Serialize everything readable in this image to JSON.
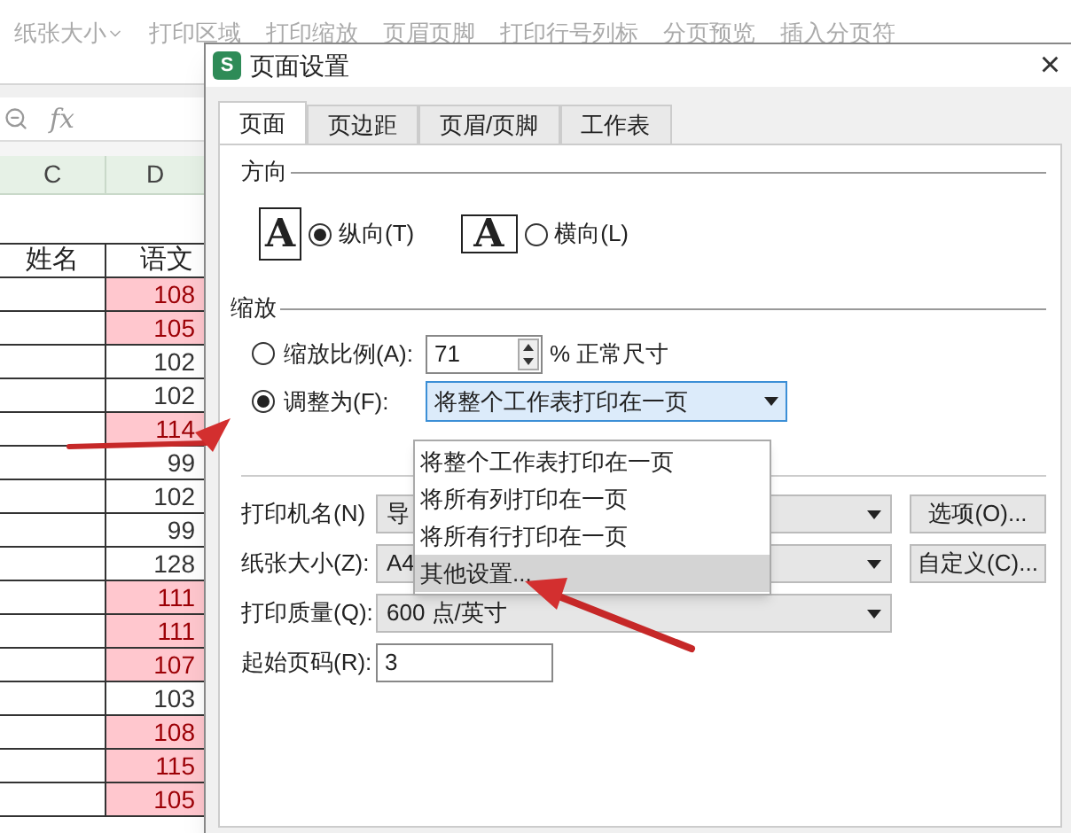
{
  "ribbon": {
    "items": [
      {
        "label": "纸张大小",
        "caret": true
      },
      {
        "label": "打印区域",
        "caret": false
      },
      {
        "label": "打印缩放",
        "caret": false
      },
      {
        "label": "页眉页脚",
        "caret": false
      },
      {
        "label": "打印行号列标",
        "caret": false
      },
      {
        "label": "分页预览",
        "caret": false
      },
      {
        "label": "插入分页符",
        "caret": false
      }
    ]
  },
  "formula_bar": {
    "fx": "fx"
  },
  "sheet": {
    "columns": [
      "C",
      "D"
    ],
    "header": [
      "姓名",
      "语文"
    ],
    "rows": [
      {
        "value": "108",
        "highlighted": true
      },
      {
        "value": "105",
        "highlighted": true
      },
      {
        "value": "102",
        "highlighted": false
      },
      {
        "value": "102",
        "highlighted": false
      },
      {
        "value": "114",
        "highlighted": true
      },
      {
        "value": "99",
        "highlighted": false
      },
      {
        "value": "102",
        "highlighted": false
      },
      {
        "value": "99",
        "highlighted": false
      },
      {
        "value": "128",
        "highlighted": false
      },
      {
        "value": "111",
        "highlighted": true
      },
      {
        "value": "111",
        "highlighted": true
      },
      {
        "value": "107",
        "highlighted": true
      },
      {
        "value": "103",
        "highlighted": false
      },
      {
        "value": "108",
        "highlighted": true
      },
      {
        "value": "115",
        "highlighted": true
      },
      {
        "value": "105",
        "highlighted": true
      }
    ]
  },
  "dialog": {
    "app_icon": "S",
    "title": "页面设置",
    "close": "×",
    "tabs": [
      {
        "label": "页面",
        "selected": true
      },
      {
        "label": "页边距",
        "selected": false
      },
      {
        "label": "页眉/页脚",
        "selected": false
      },
      {
        "label": "工作表",
        "selected": false
      }
    ],
    "orientation": {
      "label": "方向",
      "options": [
        {
          "kind": "portrait",
          "icon": "A",
          "label": "纵向(T)",
          "selected": true
        },
        {
          "kind": "landscape",
          "icon": "A",
          "label": "横向(L)",
          "selected": false
        }
      ]
    },
    "scaling": {
      "label": "缩放",
      "options": [
        {
          "label": "缩放比例(A):",
          "selected": false
        },
        {
          "label": "调整为(F):",
          "selected": true
        }
      ],
      "percent": "71",
      "percent_unit": "% 正常尺寸",
      "fit_value": "将整个工作表打印在一页",
      "dropdown_items": [
        {
          "label": "将整个工作表打印在一页",
          "highlighted": false
        },
        {
          "label": "将所有列打印在一页",
          "highlighted": false
        },
        {
          "label": "将所有行打印在一页",
          "highlighted": false
        },
        {
          "label": "其他设置...",
          "highlighted": true
        }
      ]
    },
    "print_rows": [
      {
        "label": "打印机名(N)",
        "value": "导",
        "button": "选项(O)..."
      },
      {
        "label": "纸张大小(Z):",
        "value": "A4",
        "button": "自定义(C)..."
      },
      {
        "label": "打印质量(Q):",
        "value": "600 点/英寸"
      }
    ],
    "start_page": {
      "label": "起始页码(R):",
      "value": "3"
    }
  }
}
